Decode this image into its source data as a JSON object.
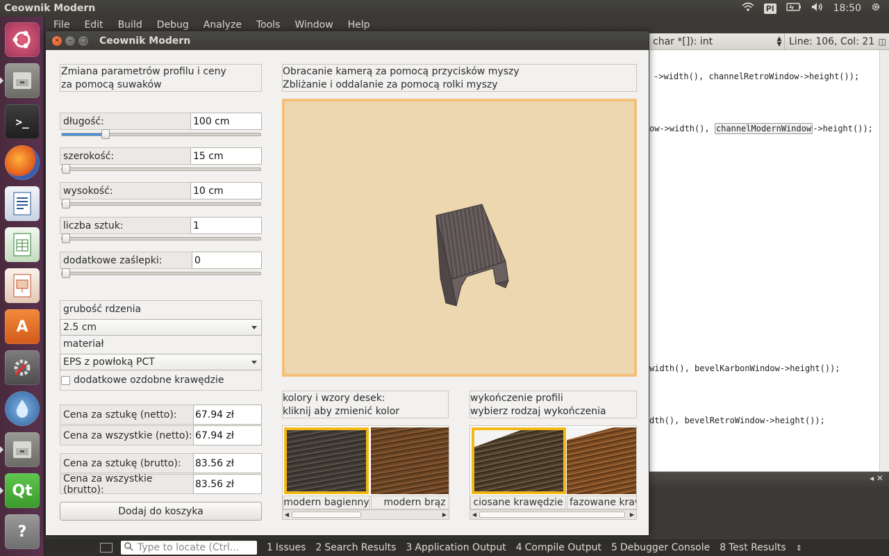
{
  "top_panel": {
    "title": "Ceownik Modern",
    "keyboard_layout": "Pl",
    "time": "18:50"
  },
  "ide": {
    "menu": [
      "File",
      "Edit",
      "Build",
      "Debug",
      "Analyze",
      "Tools",
      "Window",
      "Help"
    ],
    "editor_signature": "char *[]): int",
    "line_col": "Line: 106, Col: 21",
    "code_lines": [
      "->width(), channelRetroWindow->height());",
      "ow->width(), channelModernWindow->height());",
      "width(), bevelKarbonWindow->height());",
      "dth(), bevelRetroWindow->height());"
    ],
    "code_line_2_prefix": "ow->width(), ",
    "code_line_2_boxed": "channelModernWindow",
    "code_line_2_suffix": "->height());",
    "locate_placeholder": "Type to locate (Ctrl...",
    "output_tabs": [
      {
        "num": "1",
        "label": "Issues"
      },
      {
        "num": "2",
        "label": "Search Results"
      },
      {
        "num": "3",
        "label": "Application Output"
      },
      {
        "num": "4",
        "label": "Compile Output"
      },
      {
        "num": "5",
        "label": "Debugger Console"
      },
      {
        "num": "8",
        "label": "Test Results"
      }
    ]
  },
  "window": {
    "title": "Ceownik Modern"
  },
  "left_panel": {
    "header_line1": "Zmiana parametrów profilu i ceny",
    "header_line2": "za pomocą suwaków",
    "params": [
      {
        "label": "długość:",
        "value": "100 cm",
        "slider": 0.22
      },
      {
        "label": "szerokość:",
        "value": "15 cm",
        "slider": 0.0
      },
      {
        "label": "wysokość:",
        "value": "10 cm",
        "slider": 0.0
      },
      {
        "label": "liczba sztuk:",
        "value": "1",
        "slider": 0.0
      },
      {
        "label": "dodatkowe zaślepki:",
        "value": "0",
        "slider": 0.0
      }
    ],
    "core_label": "grubość rdzenia",
    "core_value": "2.5 cm",
    "material_label": "materiał",
    "material_value": "EPS z powłoką PCT",
    "edges_checkbox": "dodatkowe ozdobne krawędzie",
    "edges_checked": false,
    "prices": [
      {
        "label": "Cena za sztukę (netto):",
        "value": "67.94 zł"
      },
      {
        "label": "Cena za wszystkie (netto):",
        "value": "67.94 zł"
      },
      {
        "label": "Cena za sztukę (brutto):",
        "value": "83.56 zł"
      },
      {
        "label": "Cena za wszystkie (brutto):",
        "value": "83.56 zł"
      }
    ],
    "add_to_cart": "Dodaj do koszyka"
  },
  "viewport": {
    "hint_line1": "Obracanie kamerą za pomocą przycisków myszy",
    "hint_line2": "Zbliżanie i oddalanie za pomocą rolki myszy",
    "background_color": "#ecd7b1",
    "border_color": "#f3c079"
  },
  "colors_panel": {
    "header_line1": "kolory i wzory desek:",
    "header_line2": "kliknij aby zmienić kolor",
    "items": [
      {
        "label": "modern bagienny",
        "selected": true
      },
      {
        "label": "modern brąz",
        "selected": false
      }
    ]
  },
  "finish_panel": {
    "header_line1": "wykończenie profili",
    "header_line2": "wybierz rodzaj wykończenia",
    "items": [
      {
        "label": "ciosane krawędzie",
        "selected": true
      },
      {
        "label": "fazowane krawędzie",
        "selected": false
      }
    ]
  },
  "colors": {
    "selection": "#f2b815",
    "slider_fill": "#4a90d9"
  }
}
